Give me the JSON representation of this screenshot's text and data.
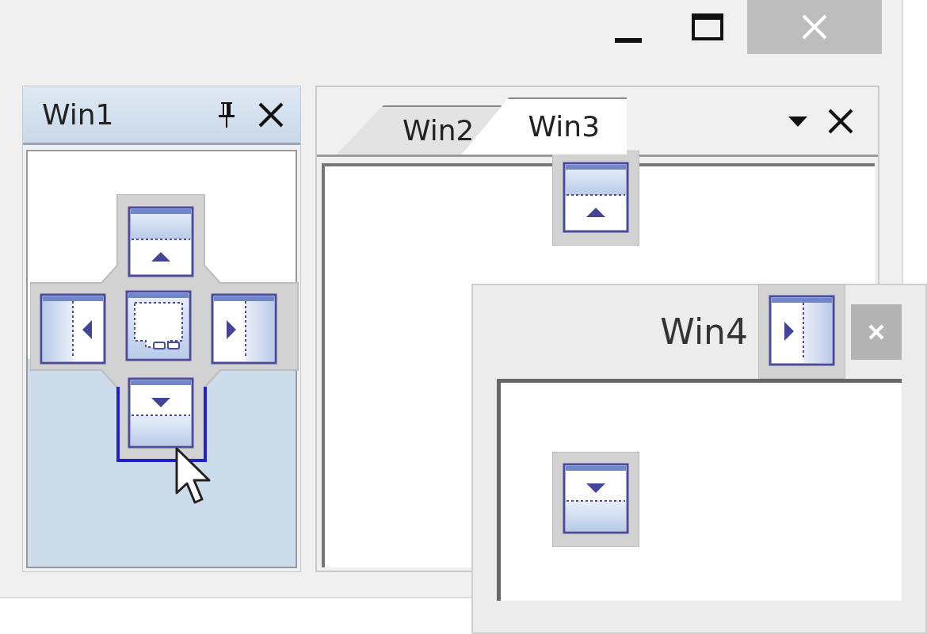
{
  "dock_panel": {
    "title": "Win1"
  },
  "document_tabs": [
    {
      "label": "Win2",
      "selected": false
    },
    {
      "label": "Win3",
      "selected": true
    }
  ],
  "floating_window": {
    "title": "Win4"
  }
}
